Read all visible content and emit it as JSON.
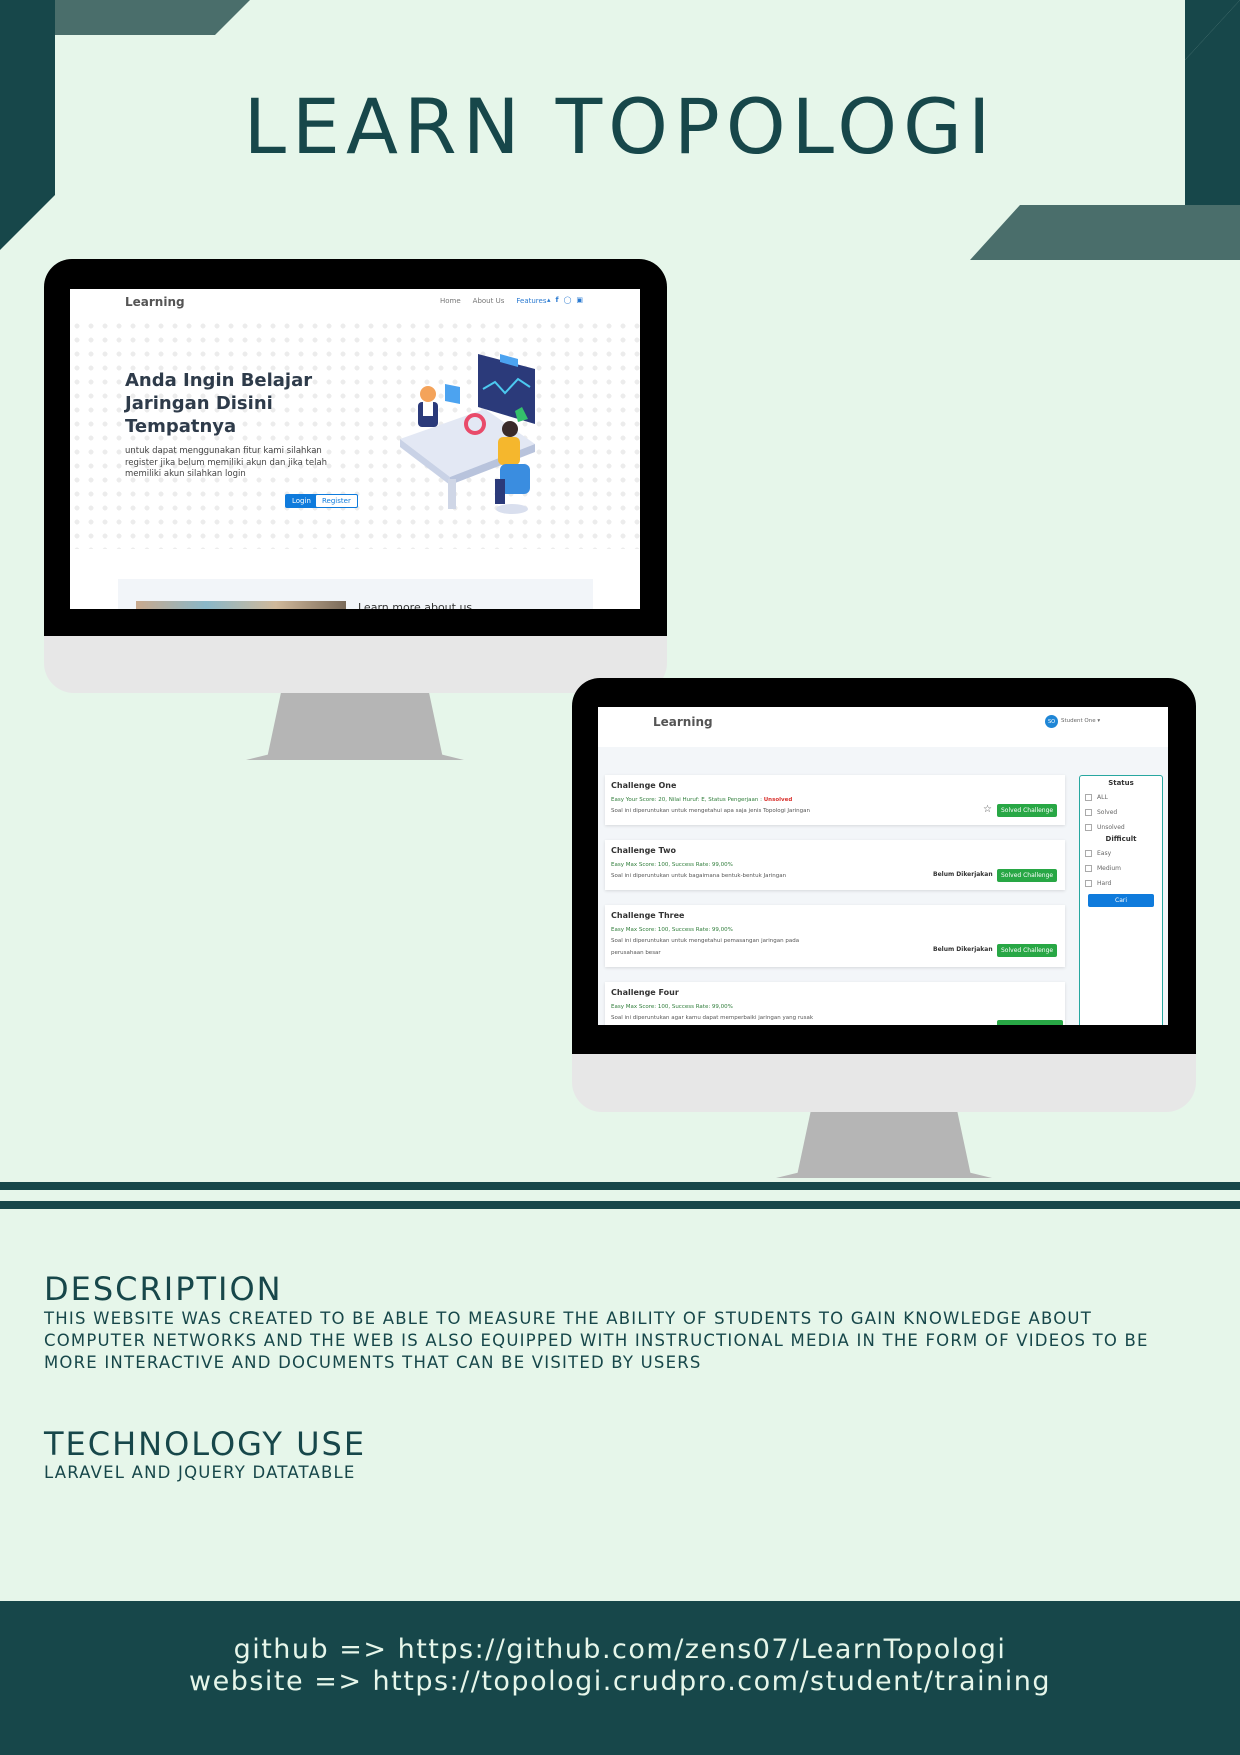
{
  "poster": {
    "title": "LEARN TOPOLOGI",
    "description_heading": "DESCRIPTION",
    "description_text": "THIS WEBSITE WAS CREATED TO BE ABLE TO MEASURE THE ABILITY OF STUDENTS TO GAIN KNOWLEDGE ABOUT COMPUTER NETWORKS AND THE WEB IS ALSO EQUIPPED WITH INSTRUCTIONAL MEDIA IN THE FORM OF VIDEOS TO BE MORE INTERACTIVE AND DOCUMENTS THAT CAN BE VISITED BY USERS",
    "technology_heading": "TECHNOLOGY USE",
    "technology_text": "LARAVEL AND JQUERY DATATABLE",
    "github_line": "github => https://github.com/zens07/LearnTopologi",
    "website_line": "website => https://topologi.crudpro.com/student/training"
  },
  "landing": {
    "brand": "Learning",
    "nav": [
      "Home",
      "About Us",
      "Features"
    ],
    "hero_title_1": "Anda Ingin Belajar",
    "hero_title_2": "Jaringan Disini",
    "hero_title_3": "Tempatnya",
    "hero_text": "untuk dapat menggunakan fitur kami silahkan register jika belum memiliki akun dan jika telah memiliki akun silahkan login",
    "login": "Login",
    "register": "Register",
    "learn_more": "Learn more about us"
  },
  "dashboard": {
    "brand": "Learning",
    "avatar": "SO",
    "user": "Student One",
    "challenges": [
      {
        "title": "Challenge One",
        "meta": "Easy Your Score: 20, Nilai Huruf: E, Status Pengerjaan :",
        "meta_status": "Unsolved",
        "desc": "Soal ini diperuntukan untuk mengetahui apa saja jenis Topologi Jaringan",
        "desc2": "",
        "state": "",
        "button": "Solved Challenge"
      },
      {
        "title": "Challenge Two",
        "meta": "Easy Max Score: 100, Success Rate: 99,00%",
        "meta_status": "",
        "desc": "Soal ini diperuntukan untuk bagaimana bentuk-bentuk Jaringan",
        "desc2": "",
        "state": "Belum Dikerjakan",
        "button": "Solved Challenge"
      },
      {
        "title": "Challenge Three",
        "meta": "Easy Max Score: 100, Success Rate: 99,00%",
        "meta_status": "",
        "desc": "Soal ini diperuntukan untuk mengetahui pemasangan jaringan pada",
        "desc2": "perusahaan besar",
        "state": "Belum Dikerjakan",
        "button": "Solved Challenge"
      },
      {
        "title": "Challenge Four",
        "meta": "Easy Max Score: 100, Success Rate: 99,00%",
        "meta_status": "",
        "desc": "Soal ini diperuntukan agar kamu dapat memperbaiki jaringan yang rusak",
        "desc2": "",
        "state": "",
        "button": ""
      }
    ],
    "filter": {
      "status_heading": "Status",
      "status_options": [
        "ALL",
        "Solved",
        "Unsolved"
      ],
      "difficult_heading": "Difficult",
      "difficult_options": [
        "Easy",
        "Medium",
        "Hard"
      ],
      "search_button": "Cari"
    }
  },
  "colors": {
    "bg": "#e6f6ea",
    "primary": "#17474a",
    "accent_shape": "#4a6e6b",
    "success": "#28a745",
    "link": "#0f7bdc"
  }
}
